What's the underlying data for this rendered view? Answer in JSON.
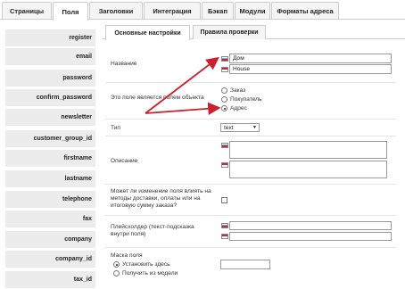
{
  "top_tabs": [
    "Страницы",
    "Поля",
    "Заголовки",
    "Интеграция",
    "Бэкап",
    "Модули",
    "Форматы адреса"
  ],
  "sidebar_items": [
    "register",
    "email",
    "password",
    "confirm_password",
    "newsletter",
    "customer_group_id",
    "firstname",
    "lastname",
    "telephone",
    "fax",
    "company",
    "company_id",
    "tax_id"
  ],
  "sub_tabs": [
    "Основные настройки",
    "Правила проверки"
  ],
  "form": {
    "name_label": "Название",
    "name_ru": "Дом",
    "name_en": "House",
    "object_label": "Это поле является полем объекта",
    "object_options": [
      "Заказ",
      "Покупатель",
      "Адрес"
    ],
    "type_label": "Тип",
    "type_value": "text",
    "description_label": "Описание",
    "shipping_label": "Может ли изменение поля влиять на методы доставки, оплаты или на итоговую сумму заказа?",
    "placeholder_label": "Плейсхолдер (текст-подсказка внутри поля)",
    "mask_label": "Маска поля",
    "mask_options": [
      "Установить здесь",
      "Получить из модели"
    ]
  },
  "icons": {
    "flag_ru": "russia-flag-icon",
    "flag_en": "uk-flag-icon",
    "arrow": "red-arrow-annotation"
  },
  "colors": {
    "arrow": "#cc1f2d",
    "sidebar_bg": "#ececec"
  }
}
